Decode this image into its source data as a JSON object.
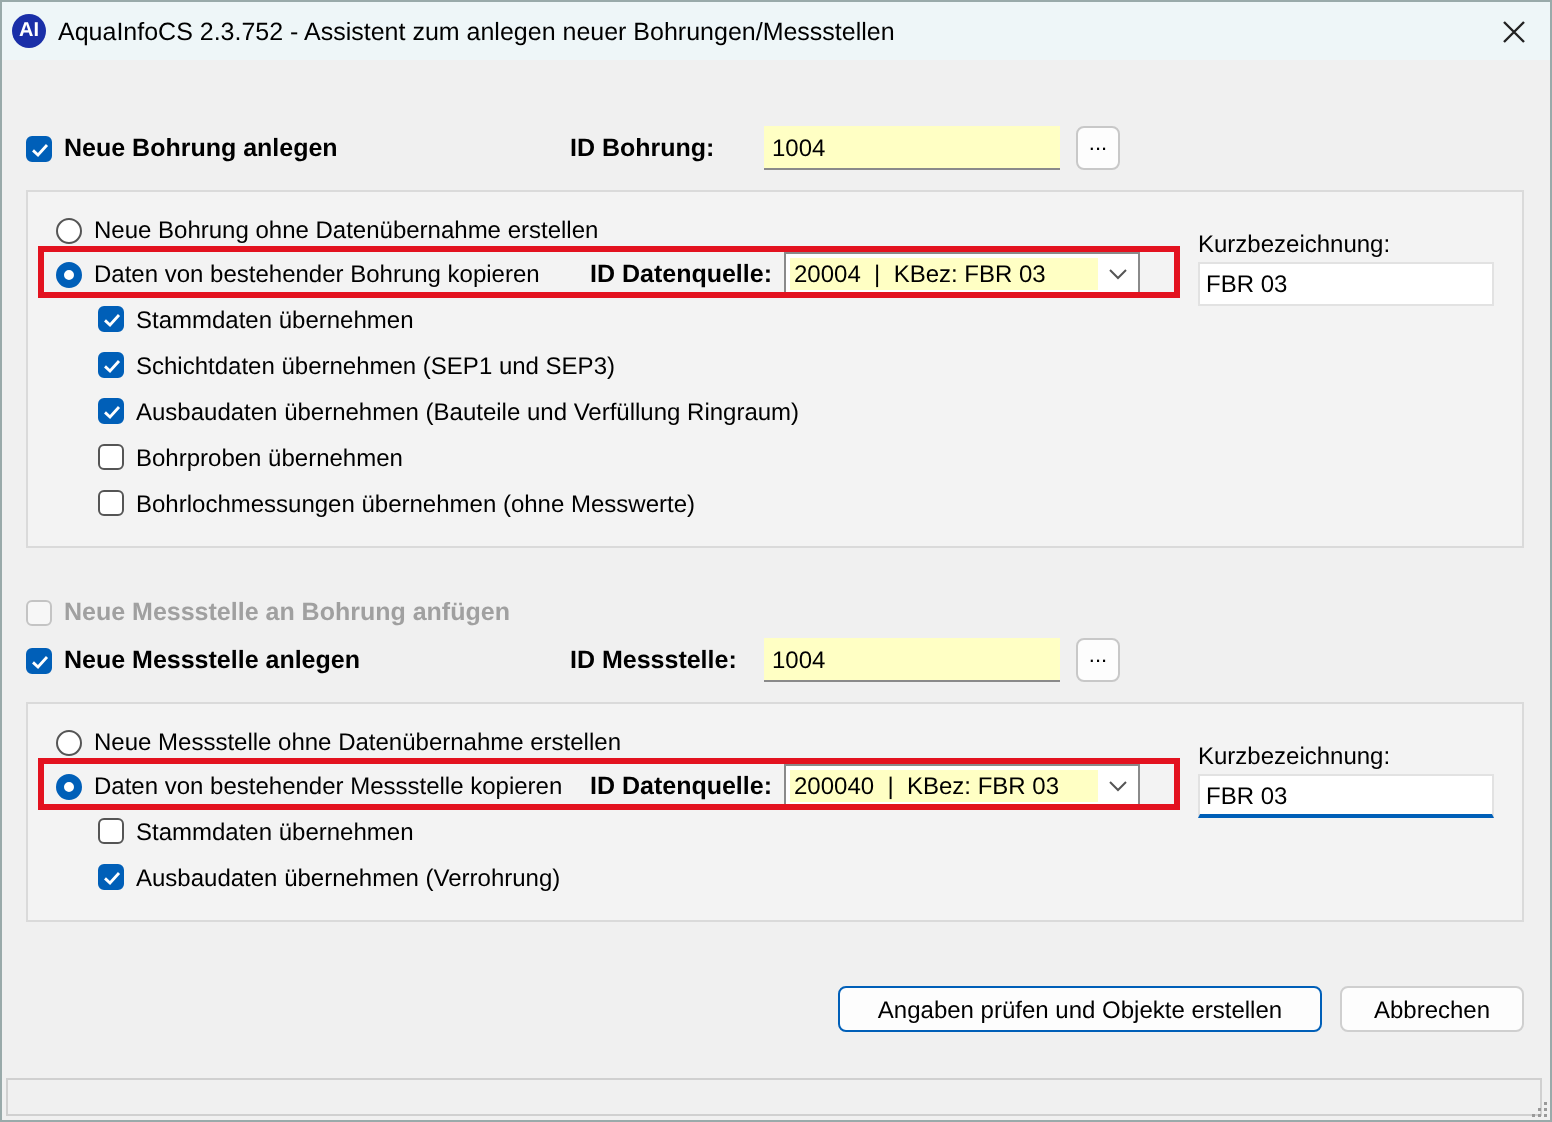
{
  "window": {
    "icon_label": "AI",
    "title": "AquaInfoCS 2.3.752 - Assistent zum anlegen neuer Bohrungen/Messstellen"
  },
  "sections": [
    {
      "header": {
        "label": "Neue Bohrung anlegen",
        "checked": true
      },
      "id_label": "ID Bohrung:",
      "id_value": "1004",
      "browse": "...",
      "radios": [
        {
          "label": "Neue Bohrung ohne Datenübernahme erstellen",
          "selected": false
        },
        {
          "label": "Daten von bestehender Bohrung kopieren",
          "selected": true,
          "source": {
            "label": "ID Datenquelle:",
            "value": "20004  |  KBez: FBR 03",
            "highlighted": true
          }
        }
      ],
      "short_label": "Kurzbezeichnung:",
      "short_value": "FBR 03",
      "short_focused": false,
      "checks": [
        {
          "label": "Stammdaten übernehmen",
          "checked": true
        },
        {
          "label": "Schichtdaten übernehmen (SEP1 und SEP3)",
          "checked": true
        },
        {
          "label": "Ausbaudaten übernehmen (Bauteile und Verfüllung Ringraum)",
          "checked": true
        },
        {
          "label": "Bohrproben übernehmen",
          "checked": false
        },
        {
          "label": "Bohrlochmessungen übernehmen (ohne Messwerte)",
          "checked": false
        }
      ]
    },
    {
      "pre_checks": [
        {
          "label": "Neue Messstelle an Bohrung anfügen",
          "checked": false,
          "disabled": true
        }
      ],
      "header": {
        "label": "Neue Messstelle anlegen",
        "checked": true
      },
      "id_label": "ID Messstelle:",
      "id_value": "1004",
      "browse": "...",
      "radios": [
        {
          "label": "Neue Messstelle ohne Datenübernahme erstellen",
          "selected": false
        },
        {
          "label": "Daten von bestehender Messstelle kopieren",
          "selected": true,
          "source": {
            "label": "ID Datenquelle:",
            "value": "200040  |  KBez: FBR 03",
            "highlighted": true
          }
        }
      ],
      "short_label": "Kurzbezeichnung:",
      "short_value": "FBR 03",
      "short_focused": true,
      "checks": [
        {
          "label": "Stammdaten übernehmen",
          "checked": false
        },
        {
          "label": "Ausbaudaten übernehmen (Verrohrung)",
          "checked": true
        }
      ]
    }
  ],
  "buttons": [
    {
      "label": "Angaben prüfen und Objekte erstellen",
      "default": true
    },
    {
      "label": "Abbrechen",
      "default": false
    }
  ]
}
